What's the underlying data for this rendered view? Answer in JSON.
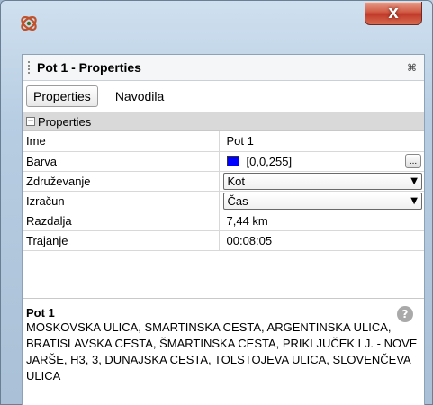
{
  "window": {
    "close_glyph": "X",
    "icon": "mapsoft-logo-icon"
  },
  "panel": {
    "title": "Pot 1 - Properties",
    "pin_glyph": "⌘",
    "tabs": [
      {
        "label": "Properties",
        "active": true
      },
      {
        "label": "Navodila",
        "active": false
      }
    ],
    "section": {
      "label": "Properties",
      "collapse_glyph": "−"
    },
    "rows": {
      "ime": {
        "name": "Ime",
        "value": "Pot 1"
      },
      "barva": {
        "name": "Barva",
        "value": "[0,0,255]",
        "color": "#0000ff",
        "button": "..."
      },
      "zdruzevanje": {
        "name": "Združevanje",
        "value": "Kot"
      },
      "izracun": {
        "name": "Izračun",
        "value": "Čas"
      },
      "razdalja": {
        "name": "Razdalja",
        "value": "7,44 km"
      },
      "trajanje": {
        "name": "Trajanje",
        "value": "00:08:05"
      }
    },
    "description": {
      "title": "Pot 1",
      "text": "MOSKOVSKA ULICA, SMARTINSKA CESTA, ARGENTINSKA ULICA, BRATISLAVSKA CESTA, ŠMARTINSKA CESTA, PRIKLJUČEK LJ. - NOVE JARŠE, H3, 3, DUNAJSKA CESTA, TOLSTOJEVA ULICA, SLOVENČEVA ULICA",
      "help_glyph": "?"
    }
  }
}
